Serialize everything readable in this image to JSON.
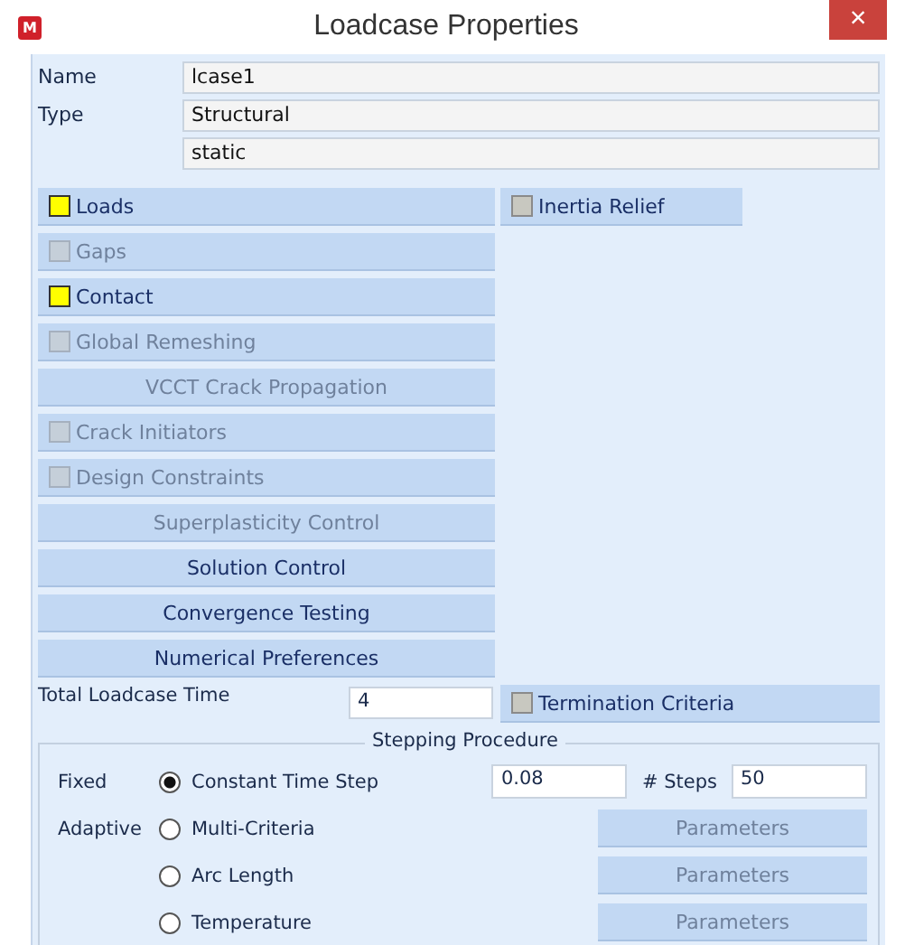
{
  "window": {
    "title": "Loadcase Properties",
    "app_icon": "M",
    "close": "×"
  },
  "fields": [
    {
      "label": "Name",
      "value": "lcase1"
    },
    {
      "label": "Type",
      "value": "Structural"
    },
    {
      "value": "static"
    }
  ],
  "buttons": [
    {
      "kind": "toggle",
      "label": "Loads",
      "active": true,
      "disabled": false
    },
    {
      "kind": "toggle",
      "label": "Gaps",
      "active": false,
      "disabled": true
    },
    {
      "kind": "toggle",
      "label": "Contact",
      "active": true,
      "disabled": false
    },
    {
      "kind": "toggle",
      "label": "Global Remeshing",
      "active": false,
      "disabled": true
    },
    {
      "kind": "plain",
      "label": "VCCT Crack Propagation",
      "disabled": true
    },
    {
      "kind": "toggle",
      "label": "Crack Initiators",
      "active": false,
      "disabled": true
    },
    {
      "kind": "toggle",
      "label": "Design Constraints",
      "active": false,
      "disabled": true
    },
    {
      "kind": "plain",
      "label": "Superplasticity Control",
      "disabled": true
    },
    {
      "kind": "plain",
      "label": "Solution Control",
      "disabled": false
    },
    {
      "kind": "plain",
      "label": "Convergence Testing",
      "disabled": false
    },
    {
      "kind": "plain",
      "label": "Numerical Preferences",
      "disabled": false
    }
  ],
  "inertia_relief": {
    "label": "Inertia Relief",
    "active": false
  },
  "total_time": {
    "label": "Total Loadcase Time",
    "value": "4"
  },
  "termination": {
    "label": "Termination Criteria",
    "active": false
  },
  "stepping": {
    "title": "Stepping Procedure",
    "options": [
      {
        "group_label": "Fixed",
        "label": "Constant Time Step",
        "selected": true,
        "time_step": "0.08",
        "steps_label": "# Steps",
        "steps": "50"
      },
      {
        "group_label": "Adaptive",
        "label": "Multi-Criteria",
        "selected": false,
        "button": {
          "label": "Parameters",
          "disabled": true
        }
      },
      {
        "label": "Arc Length",
        "selected": false,
        "button": {
          "label": "Parameters",
          "disabled": true
        }
      },
      {
        "label": "Temperature",
        "selected": false,
        "button": {
          "label": "Parameters",
          "disabled": true
        }
      }
    ]
  }
}
